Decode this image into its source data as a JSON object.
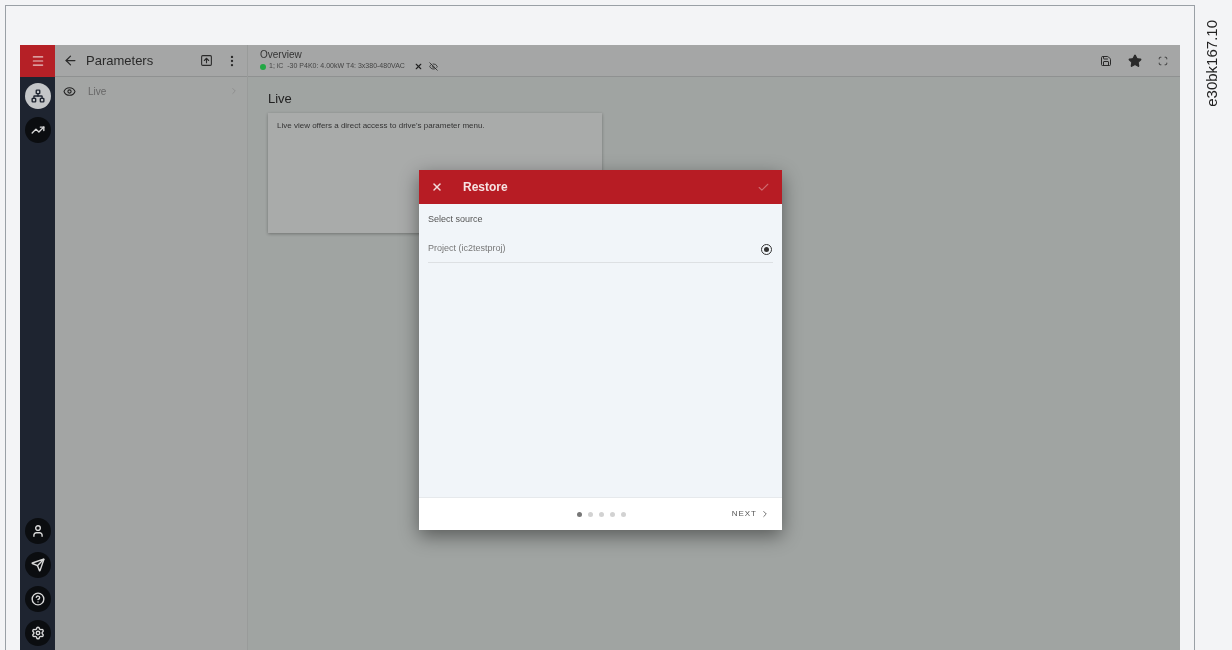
{
  "figure_label": "e30bk167.10",
  "rail": {
    "menu_selected": true,
    "top_items": [
      {
        "kind": "network",
        "selected": true
      },
      {
        "kind": "trend",
        "selected": false
      }
    ],
    "bottom_items": [
      {
        "kind": "user",
        "selected": false
      },
      {
        "kind": "send",
        "selected": false
      },
      {
        "kind": "help",
        "selected": false
      },
      {
        "kind": "settings",
        "selected": false
      }
    ]
  },
  "panel": {
    "title": "Parameters",
    "items": [
      {
        "label": "Live",
        "selected": false
      }
    ]
  },
  "header": {
    "title": "Overview",
    "devices": [
      {
        "color": "#22a845",
        "label": "1; iC  -30 P4K0: 4.00kW T4: 3x380-480VAC"
      }
    ]
  },
  "content": {
    "title": "Live",
    "description": "Live view offers a direct access to drive's parameter menu."
  },
  "dialog": {
    "title": "Restore",
    "confirm_disabled": true,
    "section_label": "Select source",
    "options": [
      {
        "label": "Project (ic2testproj)",
        "selected": true
      }
    ],
    "steps": [
      {
        "selected": true
      },
      {
        "selected": false
      },
      {
        "selected": false
      },
      {
        "selected": false
      },
      {
        "selected": false
      }
    ],
    "next_label": "NEXT"
  }
}
